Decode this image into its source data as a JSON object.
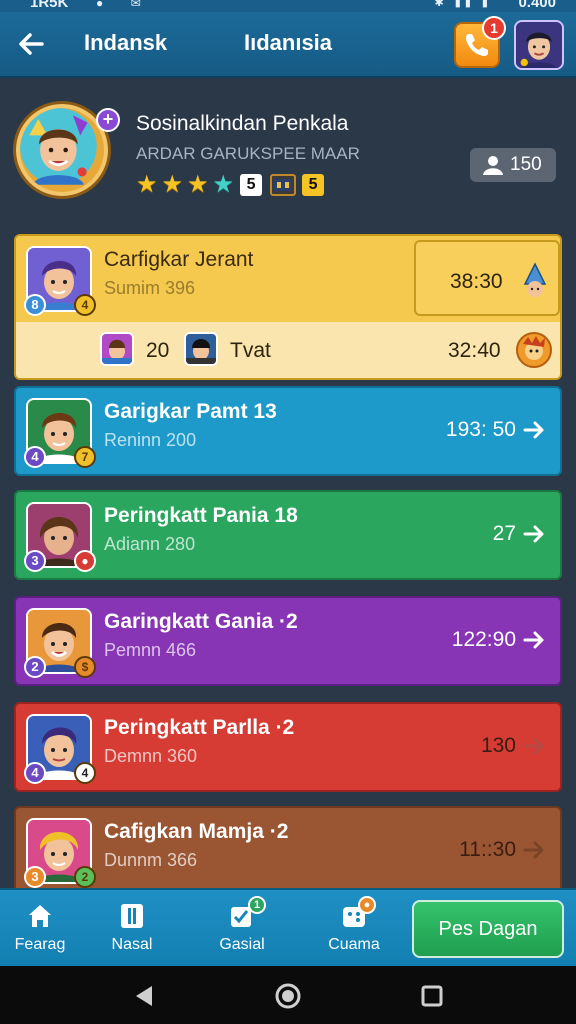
{
  "status_bar": {
    "left_text": "1R5K",
    "right_text": "0.400"
  },
  "header": {
    "back_icon": "arrow-left-icon",
    "title_left": "Indansk",
    "title_center": "Iıdanısia",
    "call_badge": "1",
    "colors": {
      "bar": "#1c6a99",
      "call_button": "#f5a623"
    }
  },
  "profile": {
    "name": "Sosinalkindan Penkala",
    "subtitle": "ARDAR GARUKSPEE MAAR",
    "stars_gold": 3,
    "level_a": "5",
    "level_b": "5",
    "followers": "150"
  },
  "featured": {
    "name": "Carfigkar Jerant",
    "sub": "Sumim 396",
    "score": "38:30",
    "rank": "8",
    "medal": "4",
    "bottom_num": "20",
    "bottom_name": "Tvat",
    "bottom_score": "32:40"
  },
  "rows": [
    {
      "name": "Garigkar Pamt 13",
      "sub": "Reninn 200",
      "score": "193: 50",
      "rank": "4",
      "medal": "7",
      "color": "#1d9ac9"
    },
    {
      "name": "Peringkatt Pania 18",
      "sub": "Adiann 280",
      "score": "27",
      "rank": "3",
      "medal": "",
      "color": "#2aa65f"
    },
    {
      "name": "Garingkatt Gania ·2",
      "sub": "Pemnn 466",
      "score": "122:90",
      "rank": "2",
      "medal": "",
      "color": "#8735b4"
    },
    {
      "name": "Peringkatt Parlla ·2",
      "sub": "Demnn 360",
      "score": "130",
      "rank": "4",
      "medal": "4",
      "color": "#d63c34"
    },
    {
      "name": "Cafigkan Mamja ·2",
      "sub": "Dunnm 366",
      "score": "11::30",
      "rank": "3",
      "medal": "2",
      "color": "#9a5532"
    }
  ],
  "bottom_nav": {
    "items": [
      {
        "label": "Fearag",
        "icon": "home-icon"
      },
      {
        "label": "Nasal",
        "icon": "list-icon"
      },
      {
        "label": "Gasial",
        "icon": "tasks-icon",
        "badge": "1"
      },
      {
        "label": "Cuama",
        "icon": "dice-icon",
        "badge": ""
      }
    ],
    "cta_label": "Pes Dagan"
  }
}
